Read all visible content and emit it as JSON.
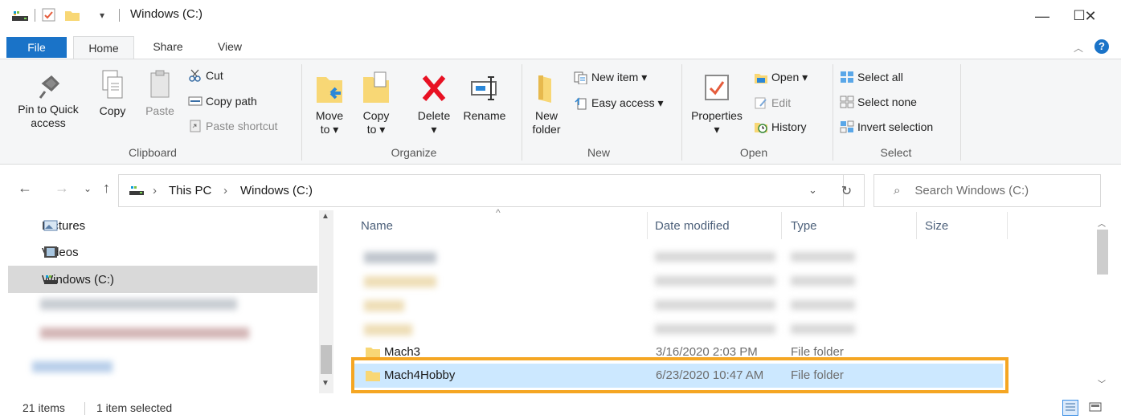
{
  "window": {
    "title": "Windows (C:)"
  },
  "window_controls": {
    "minimize": "—",
    "maximize": "☐",
    "close": "✕"
  },
  "tabs": [
    {
      "label": "File"
    },
    {
      "label": "Home"
    },
    {
      "label": "Share"
    },
    {
      "label": "View"
    }
  ],
  "ribbon": {
    "clipboard": {
      "pin_line1": "Pin to Quick",
      "pin_line2": "access",
      "copy": "Copy",
      "paste": "Paste",
      "cut": "Cut",
      "copy_path": "Copy path",
      "paste_shortcut": "Paste shortcut",
      "label": "Clipboard"
    },
    "organize": {
      "move_line1": "Move",
      "move_line2": "to ▾",
      "copyto_line1": "Copy",
      "copyto_line2": "to ▾",
      "delete": "Delete",
      "delete_arrow": "▾",
      "rename": "Rename",
      "label": "Organize"
    },
    "new": {
      "new_folder_line1": "New",
      "new_folder_line2": "folder",
      "new_item": "New item ▾",
      "easy_access": "Easy access ▾",
      "label": "New"
    },
    "open": {
      "properties": "Properties",
      "properties_arrow": "▾",
      "open": "Open ▾",
      "edit": "Edit",
      "history": "History",
      "label": "Open"
    },
    "select": {
      "select_all": "Select all",
      "select_none": "Select none",
      "invert": "Invert selection",
      "label": "Select"
    }
  },
  "address": {
    "crumbs": [
      "This PC",
      "Windows (C:)"
    ],
    "separator": "›",
    "search_placeholder": "Search Windows (C:)"
  },
  "navpane": {
    "items": [
      {
        "label": "Pictures"
      },
      {
        "label": "Videos"
      },
      {
        "label": "Windows (C:)"
      }
    ]
  },
  "columns": [
    {
      "label": "Name"
    },
    {
      "label": "Date modified"
    },
    {
      "label": "Type"
    },
    {
      "label": "Size"
    }
  ],
  "files": [
    {
      "name": "Mach3",
      "date": "3/16/2020 2:03 PM",
      "type": "File folder"
    },
    {
      "name": "Mach4Hobby",
      "date": "6/23/2020 10:47 AM",
      "type": "File folder"
    }
  ],
  "status": {
    "count": "21 items",
    "selected": "1 item selected"
  },
  "colors": {
    "accent": "#1a73c8",
    "selection": "#cce8ff",
    "highlight": "#f5a623",
    "folder": "#f8d775"
  }
}
